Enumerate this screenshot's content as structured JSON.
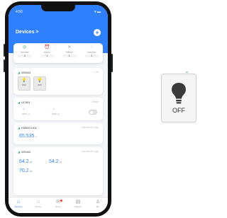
{
  "status_bar": {
    "time": "4:50",
    "icons": "▾ ▬"
  },
  "header": {
    "title": "Devices",
    "chevron": ">",
    "add_label": "+"
  },
  "stats": [
    {
      "label": "Normal",
      "count": "4",
      "icon": "check-circle-icon",
      "glyph": "◎",
      "color": "#2aa55b"
    },
    {
      "label": "Alarm",
      "count": "1",
      "icon": "alarm-icon",
      "glyph": "⏰",
      "color": "#e85050"
    },
    {
      "label": "Offline",
      "count": "1",
      "icon": "offline-icon",
      "glyph": "✕",
      "color": "#999999"
    },
    {
      "label": "Inactive",
      "count": "1",
      "icon": "inactive-icon",
      "glyph": "◌",
      "color": "#999999"
    }
  ],
  "cards": {
    "ws503": {
      "name": "WS503",
      "right": "1 2s",
      "switches": [
        {
          "state": "OFF"
        },
        {
          "state": "OFF"
        }
      ]
    },
    "uc501": {
      "name": "UC501",
      "right": "Online",
      "values": [
        {
          "key": "GPIO_1",
          "dot": "•"
        },
        {
          "key": "GPIO_2",
          "dot": "•"
        }
      ]
    },
    "em500": {
      "name": "EM500-UDL",
      "right": "Normal 6m ago",
      "value": "65.535",
      "unit": "m"
    },
    "ws302": {
      "name": "WS302",
      "right": "Normal 8m ago",
      "values": [
        {
          "value": "64.2",
          "unit": "dB"
        },
        {
          "value": "54.2",
          "unit": "dB"
        },
        {
          "value": "70.2",
          "unit": "dB"
        }
      ]
    }
  },
  "tabs": [
    {
      "label": "Devices",
      "icon": "devices-icon",
      "glyph": "⌂",
      "active": true
    },
    {
      "label": "Home",
      "icon": "home-icon",
      "glyph": "⌂",
      "active": false
    },
    {
      "label": "Event",
      "icon": "event-icon",
      "glyph": "✉",
      "active": false,
      "badge": true
    },
    {
      "label": "Report",
      "icon": "report-icon",
      "glyph": "▤",
      "active": false
    },
    {
      "label": "Me",
      "icon": "me-icon",
      "glyph": "♙",
      "active": false
    }
  ],
  "big_switch": {
    "state": "OFF",
    "icon": "lightbulb-icon"
  },
  "colors": {
    "accent": "#2f80ff",
    "online": "#2aa55b",
    "alarm": "#e85050"
  }
}
